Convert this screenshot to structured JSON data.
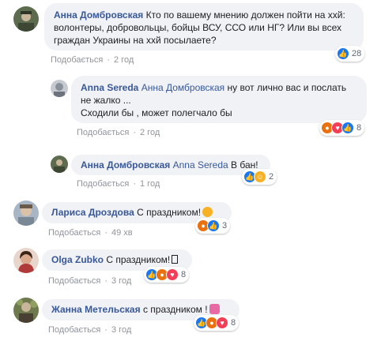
{
  "comments": [
    {
      "author": "Анна Домбровская",
      "text": "Кто по вашему мнению должен пойти на ххй: волонтеры, добровольцы, бойцы ВСУ, ССО или НГ? Или вы всех граждан Украины на ххй посылаете?",
      "like_label": "Подобається",
      "time": "2 год",
      "reaction_count": "28",
      "reactions": [
        "like-icon"
      ]
    },
    {
      "author": "Anna Sereda",
      "mention": "Анна Домбровская",
      "text_line1": "ну вот лично вас и послать не жалко ...",
      "text_line2": "Сходили бы , может полегчало бы",
      "like_label": "Подобається",
      "time": "2 год",
      "reaction_count": "8",
      "reactions": [
        "angry-icon",
        "love-icon",
        "like-icon"
      ]
    },
    {
      "author": "Анна Домбровская",
      "mention": "Anna Sereda",
      "text": "В бан!",
      "like_label": "Подобається",
      "time": "1 год",
      "reaction_count": "2",
      "reactions": [
        "like-icon",
        "haha-icon"
      ]
    },
    {
      "author": "Лариса Дроздова",
      "text": "С праздником!",
      "emoji": "party-face-emoji",
      "like_label": "Подобається",
      "time": "49 хв",
      "reaction_count": "3",
      "reactions": [
        "angry-icon",
        "like-icon"
      ]
    },
    {
      "author": "Olga Zubko",
      "text": "С праздником!",
      "like_label": "Подобається",
      "time": "3 год",
      "reaction_count": "8",
      "reactions": [
        "like-icon",
        "angry-icon",
        "love-icon"
      ]
    },
    {
      "author": "Жанна Метельская",
      "text": "с праздником !",
      "emoji": "flower-bouquet-emoji",
      "like_label": "Подобається",
      "time": "3 год",
      "reaction_count": "8",
      "reactions": [
        "like-icon",
        "angry-icon",
        "love-icon"
      ]
    }
  ],
  "colors": {
    "link": "#385898",
    "bubble": "#f0f2f5",
    "meta": "#90949c",
    "like": "#1877f2",
    "angry": "#e9710f",
    "love": "#f33e58",
    "haha": "#f7b125"
  }
}
